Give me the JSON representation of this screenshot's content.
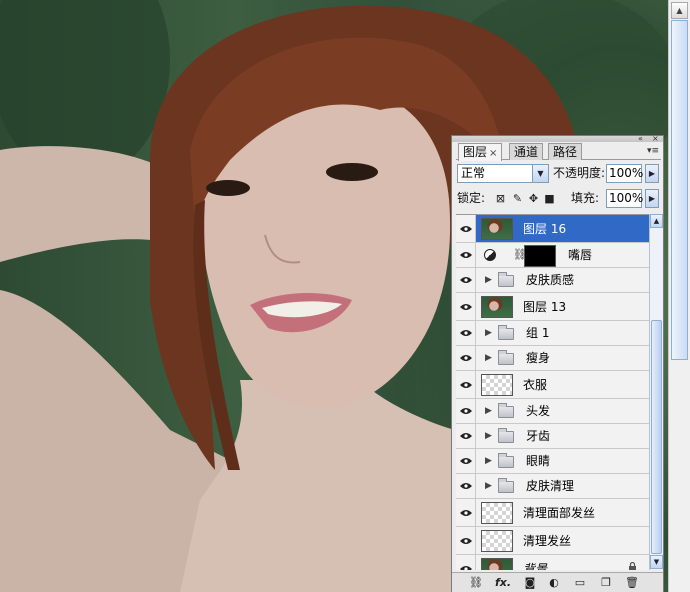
{
  "panel": {
    "tabs": [
      {
        "label": "图层",
        "close": "×",
        "active": true
      },
      {
        "label": "通道",
        "active": false
      },
      {
        "label": "路径",
        "active": false
      }
    ],
    "blend_mode": "正常",
    "opacity_label": "不透明度:",
    "opacity_value": "100%",
    "lock_label": "锁定:",
    "fill_label": "填充:",
    "fill_value": "100%"
  },
  "layers": [
    {
      "name": "图层 16",
      "kind": "photo",
      "selected": true
    },
    {
      "name": "嘴唇",
      "kind": "adjustment-mask"
    },
    {
      "name": "皮肤质感",
      "kind": "group"
    },
    {
      "name": "图层 13",
      "kind": "photo"
    },
    {
      "name": "组 1",
      "kind": "group"
    },
    {
      "name": "瘦身",
      "kind": "group"
    },
    {
      "name": "衣服",
      "kind": "transparent"
    },
    {
      "name": "头发",
      "kind": "group"
    },
    {
      "name": "牙齿",
      "kind": "group"
    },
    {
      "name": "眼睛",
      "kind": "group"
    },
    {
      "name": "皮肤清理",
      "kind": "group"
    },
    {
      "name": "清理面部发丝",
      "kind": "transparent"
    },
    {
      "name": "清理发丝",
      "kind": "transparent"
    },
    {
      "name": "背景",
      "kind": "photo",
      "locked": true
    }
  ],
  "footer_icons": [
    "link-icon",
    "fx-icon",
    "mask-icon",
    "adjustment-icon",
    "new-group-icon",
    "new-layer-icon",
    "trash-icon"
  ],
  "footer": {
    "fx": "fx."
  },
  "colors": {
    "selection": "#3169c6",
    "panel_bg": "#ededed"
  }
}
